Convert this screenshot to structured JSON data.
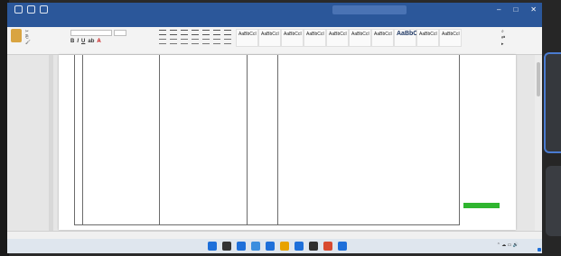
{
  "window": {
    "title": "",
    "user": "",
    "share_label": "",
    "controls": [
      "–",
      "□",
      "✕"
    ]
  },
  "ribbon": {
    "tabs": [
      "",
      "",
      "",
      "",
      "",
      "",
      "",
      "",
      "",
      "",
      ""
    ],
    "active_tab_index": 1,
    "tell_me": ""
  },
  "styles_gallery": [
    {
      "sample": "AaBbCcI",
      "name": ""
    },
    {
      "sample": "AaBbCcI",
      "name": ""
    },
    {
      "sample": "AaBbCcI",
      "name": ""
    },
    {
      "sample": "AaBbCcI",
      "name": ""
    },
    {
      "sample": "AaBbCcI",
      "name": ""
    },
    {
      "sample": "AaBbCcI",
      "name": ""
    },
    {
      "sample": "AaBbCcI",
      "name": ""
    },
    {
      "sample": "AaBbCc",
      "name": ""
    },
    {
      "sample": "AaBbCcI",
      "name": ""
    },
    {
      "sample": "AaBbCcI",
      "name": ""
    }
  ],
  "document": {
    "heading": "",
    "body_paragraphs": [],
    "right_paragraphs": []
  },
  "status": {
    "left": "",
    "zoom": ""
  },
  "taskbar": {
    "icon_colors": [
      "#1e6fd9",
      "#333333",
      "#1e6fd9",
      "#3b8ede",
      "#1e6fd9",
      "#e8a200",
      "#1e6fd9",
      "#2f2f2f",
      "#d84a2f",
      "#1e6fd9"
    ],
    "time": "",
    "date": ""
  },
  "colors": {
    "word_blue": "#2b579a",
    "highlight_green": "#2fb52f"
  }
}
